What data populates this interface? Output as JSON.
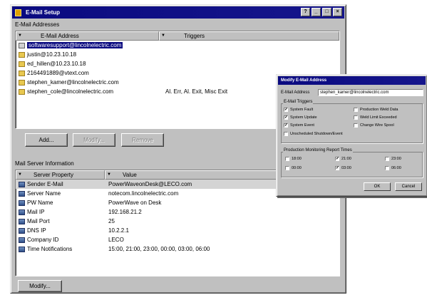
{
  "main_window": {
    "title": "E-Mail Setup",
    "title_buttons": [
      "?",
      "_",
      "□",
      "×"
    ],
    "email_section_label": "E-Mail Addresses",
    "email_columns": [
      "E-Mail Address",
      "Triggers"
    ],
    "email_rows": [
      {
        "address": "softwaresupport@lincolnelectric.com",
        "triggers": "",
        "selected": true,
        "icon": "envelope-open-icon"
      },
      {
        "address": "justin@10.23.10.18",
        "triggers": "",
        "icon": "envelope-icon"
      },
      {
        "address": "ed_hillen@10.23.10.18",
        "triggers": "",
        "icon": "envelope-icon"
      },
      {
        "address": "2164491889@vtext.com",
        "triggers": "",
        "icon": "envelope-icon"
      },
      {
        "address": "stephen_kamer@lincolnelectric.com",
        "triggers": "",
        "icon": "envelope-icon"
      },
      {
        "address": "stephen_cole@lincolnelectric.com",
        "triggers": "Al. Err, Al. Exit, Misc Exit",
        "icon": "envelope-icon"
      }
    ],
    "email_buttons": {
      "add": "Add...",
      "modify": "Modify...",
      "remove": "Remove"
    },
    "server_section_label": "Mail Server Information",
    "server_columns": [
      "Server Property",
      "Value"
    ],
    "server_rows": [
      {
        "property": "Sender E-Mail",
        "value": "PowerWaveonDesk@LECO.com",
        "selected": true
      },
      {
        "property": "Server Name",
        "value": "notecom.lincolnelectric.com"
      },
      {
        "property": "PW Name",
        "value": "PowerWave on Desk"
      },
      {
        "property": "Mail IP",
        "value": "192.168.21.2"
      },
      {
        "property": "Mail Port",
        "value": "25"
      },
      {
        "property": "DNS IP",
        "value": "10.2.2.1"
      },
      {
        "property": "Company ID",
        "value": "LECO"
      },
      {
        "property": "Time Notifications",
        "value": "15:00, 21:00, 23:00, 00:00, 03:00, 06:00"
      }
    ],
    "server_buttons": {
      "modify": "Modify..."
    }
  },
  "dialog": {
    "title": "Modify E-Mail Address",
    "address_label": "E-Mail Address",
    "address_value": "stephen_kamer@lincolnelectric.com",
    "triggers_label": "E-Mail Triggers",
    "triggers": [
      {
        "label": "System Fault",
        "checked": true
      },
      {
        "label": "Production Weld Data",
        "checked": false
      },
      {
        "label": "System Update",
        "checked": true
      },
      {
        "label": "Weld Limit Exceeded",
        "checked": false
      },
      {
        "label": "System Event",
        "checked": true
      },
      {
        "label": "Change Wire Spool",
        "checked": false
      },
      {
        "label": "Unscheduled Shutdown/Event",
        "checked": false
      }
    ],
    "times_label": "Production Monitoring Report Times",
    "times": [
      {
        "label": "18:00",
        "checked": false
      },
      {
        "label": "21:00",
        "checked": true
      },
      {
        "label": "23:00",
        "checked": false
      },
      {
        "label": "00:00",
        "checked": false
      },
      {
        "label": "03:00",
        "checked": true
      },
      {
        "label": "06:00",
        "checked": false
      }
    ],
    "ok_label": "OK",
    "cancel_label": "Cancel"
  }
}
